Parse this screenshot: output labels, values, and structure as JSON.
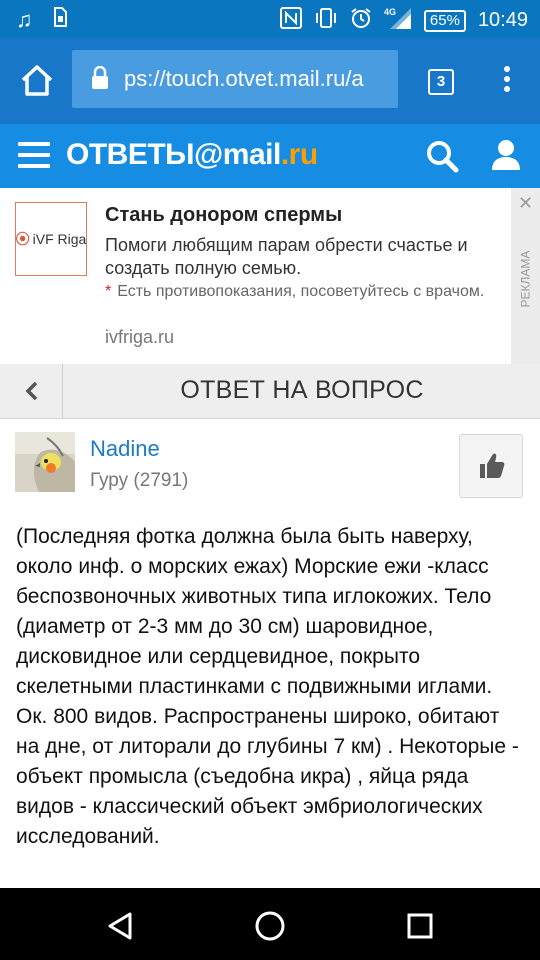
{
  "status_bar": {
    "left_icons": [
      "music-note-icon",
      "sim-card-icon"
    ],
    "right_icons": [
      "nfc-icon",
      "vibrate-icon",
      "alarm-icon",
      "signal-4g-icon"
    ],
    "battery": "65%",
    "time": "10:49"
  },
  "browser": {
    "url": "ps://touch.otvet.mail.ru/a",
    "tab_count": "3"
  },
  "site_header": {
    "logo_main": "ОТВЕТЫ",
    "logo_at": "@",
    "logo_domain": "mail",
    "logo_tld": ".ru"
  },
  "ad": {
    "logo_text": "iVF Riga",
    "title": "Стань донором спермы",
    "description": "Помоги любящим парам обрести счастье и создать полную семью.",
    "note_mark": "*",
    "note": "Есть противопоказания, посоветуйтесь с врачом.",
    "domain": "ivfriga.ru",
    "close": "✕",
    "label": "РЕКЛАМА"
  },
  "page_header": {
    "back_icon": "chevron-left-icon",
    "title": "ОТВЕТ НА ВОПРОС"
  },
  "answer": {
    "user_name": "Nadine",
    "user_rank": "Гуру (2791)",
    "like_icon": "thumbs-up-icon",
    "text": "(Последняя фотка должна была быть наверху, около инф. о морских ежах) Морские ежи -класс беспозвоночных животных типа иглокожих. Тело (диаметр от 2-3 мм до 30 см) шаровидное, дисковидное или сердцевидное, покрыто скелетными пластинками с подвижными иглами. Ок. 800 видов. Распространены широко, обитают на дне, от литорали до глубины 7 км) . Некоторые - объект промысла (съедобна икра) , яйца ряда видов - классический объект эмбриологических исследований."
  },
  "colors": {
    "status_bar": "#0a76bf",
    "browser_bar": "#1977c9",
    "site_bar": "#168de2",
    "logo_accent": "#ff9e00",
    "link": "#1a7bc7"
  }
}
